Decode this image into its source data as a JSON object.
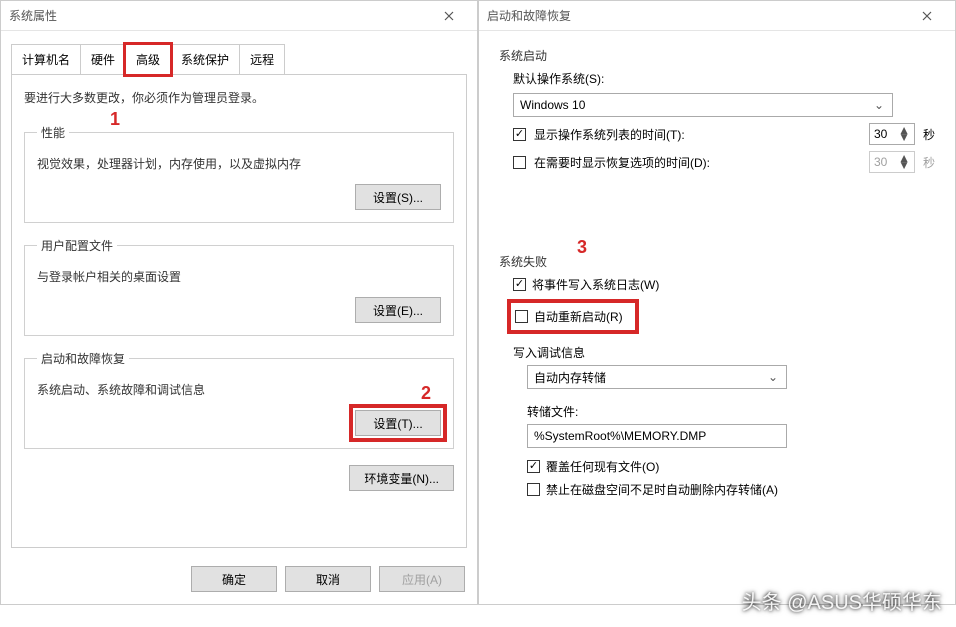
{
  "left": {
    "title": "系统属性",
    "tabs": {
      "computer_name": "计算机名",
      "hardware": "硬件",
      "advanced": "高级",
      "system_protection": "系统保护",
      "remote": "远程"
    },
    "admin_note": "要进行大多数更改，你必须作为管理员登录。",
    "performance": {
      "legend": "性能",
      "desc": "视觉效果，处理器计划，内存使用，以及虚拟内存",
      "btn": "设置(S)..."
    },
    "profiles": {
      "legend": "用户配置文件",
      "desc": "与登录帐户相关的桌面设置",
      "btn": "设置(E)..."
    },
    "startup": {
      "legend": "启动和故障恢复",
      "desc": "系统启动、系统故障和调试信息",
      "btn": "设置(T)..."
    },
    "env_btn": "环境变量(N)...",
    "ok": "确定",
    "cancel": "取消",
    "apply": "应用(A)"
  },
  "right": {
    "title": "启动和故障恢复",
    "system_startup": {
      "heading": "系统启动",
      "default_os_label": "默认操作系统(S):",
      "default_os_value": "Windows 10",
      "show_os_list": "显示操作系统列表的时间(T):",
      "show_os_list_value": "30",
      "show_recovery": "在需要时显示恢复选项的时间(D):",
      "show_recovery_value": "30",
      "seconds": "秒"
    },
    "system_failure": {
      "heading": "系统失败",
      "write_event": "将事件写入系统日志(W)",
      "auto_restart": "自动重新启动(R)",
      "write_debug": "写入调试信息",
      "dump_type": "自动内存转储",
      "dump_file_label": "转储文件:",
      "dump_file_value": "%SystemRoot%\\MEMORY.DMP",
      "overwrite": "覆盖任何现有文件(O)",
      "disable_auto_delete": "禁止在磁盘空间不足时自动删除内存转储(A)"
    }
  },
  "annotations": {
    "n1": "1",
    "n2": "2",
    "n3": "3"
  },
  "watermark": "头条 @ASUS华硕华东"
}
